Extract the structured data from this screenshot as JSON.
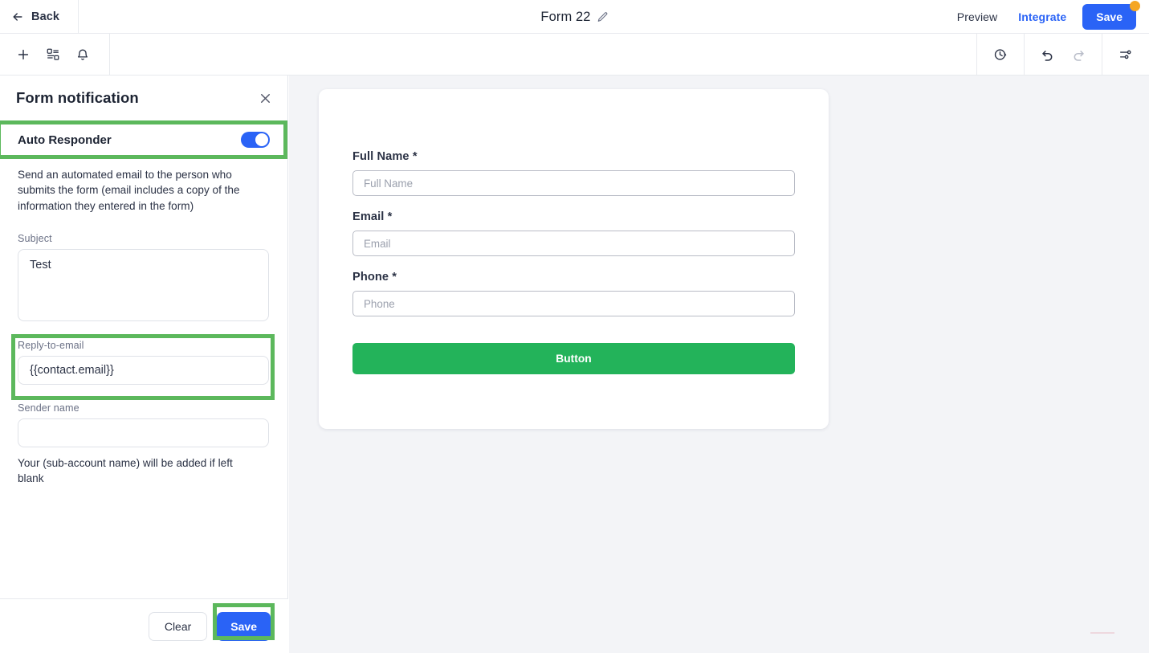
{
  "topbar": {
    "back_label": "Back",
    "back_icon": "arrow-left-icon",
    "form_title": "Form 22",
    "edit_icon": "pencil-icon",
    "preview_label": "Preview",
    "integrate_label": "Integrate",
    "save_label": "Save",
    "save_badge_color": "#f5a623",
    "accent_blue": "#2a63f6"
  },
  "toolbar": {
    "left_icons": [
      "plus-icon",
      "elements-icon",
      "bell-icon"
    ],
    "right_icons": [
      "history-clock-icon",
      "undo-icon",
      "redo-icon",
      "settings-sliders-icon"
    ]
  },
  "panel": {
    "title": "Form notification",
    "close_icon": "close-icon",
    "auto_responder": {
      "label": "Auto Responder",
      "toggle_state": "on",
      "toggle_color": "#2a63f6"
    },
    "description": "Send an automated email to the person who submits the form (email includes a copy of the information they entered in the form)",
    "subject": {
      "label": "Subject",
      "value": "Test",
      "placeholder": ""
    },
    "reply_to_email": {
      "label": "Reply-to-email",
      "value": "{{contact.email}}",
      "placeholder": ""
    },
    "sender_name": {
      "label": "Sender name",
      "value": "",
      "placeholder": ""
    },
    "sender_hint": "Your (sub-account name) will be added if left blank",
    "footer": {
      "clear_label": "Clear",
      "save_label": "Save"
    }
  },
  "highlights": {
    "color": "#5cb85c",
    "targets": [
      "auto-responder-row",
      "reply-to-email-field",
      "panel-save-button"
    ]
  },
  "preview": {
    "fields": [
      {
        "label": "Full Name",
        "required": "*",
        "placeholder": "Full Name",
        "value": ""
      },
      {
        "label": "Email",
        "required": "*",
        "placeholder": "Email",
        "value": ""
      },
      {
        "label": "Phone",
        "required": "*",
        "placeholder": "Phone",
        "value": ""
      }
    ],
    "submit_label": "Button",
    "submit_color": "#23b35a"
  }
}
